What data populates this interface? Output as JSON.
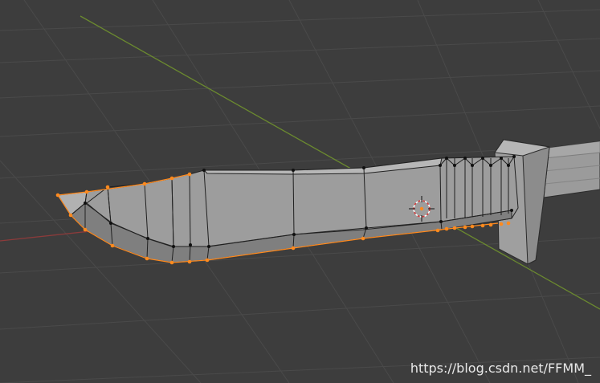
{
  "viewport": {
    "mode": "3D Viewport - Edit Mode",
    "background_color": "#3d3d3d",
    "grid_color": "#4a4a4a",
    "x_axis_color": "#8c3b3b",
    "y_axis_color": "#6b8a2f",
    "mesh_face_color": "#9a9a9a",
    "mesh_edge_color": "#222222",
    "selected_color": "#ff8a1e",
    "cursor_icon": "3d-cursor-icon"
  },
  "watermark": {
    "text": "https://blog.csdn.net/FFMM_"
  }
}
